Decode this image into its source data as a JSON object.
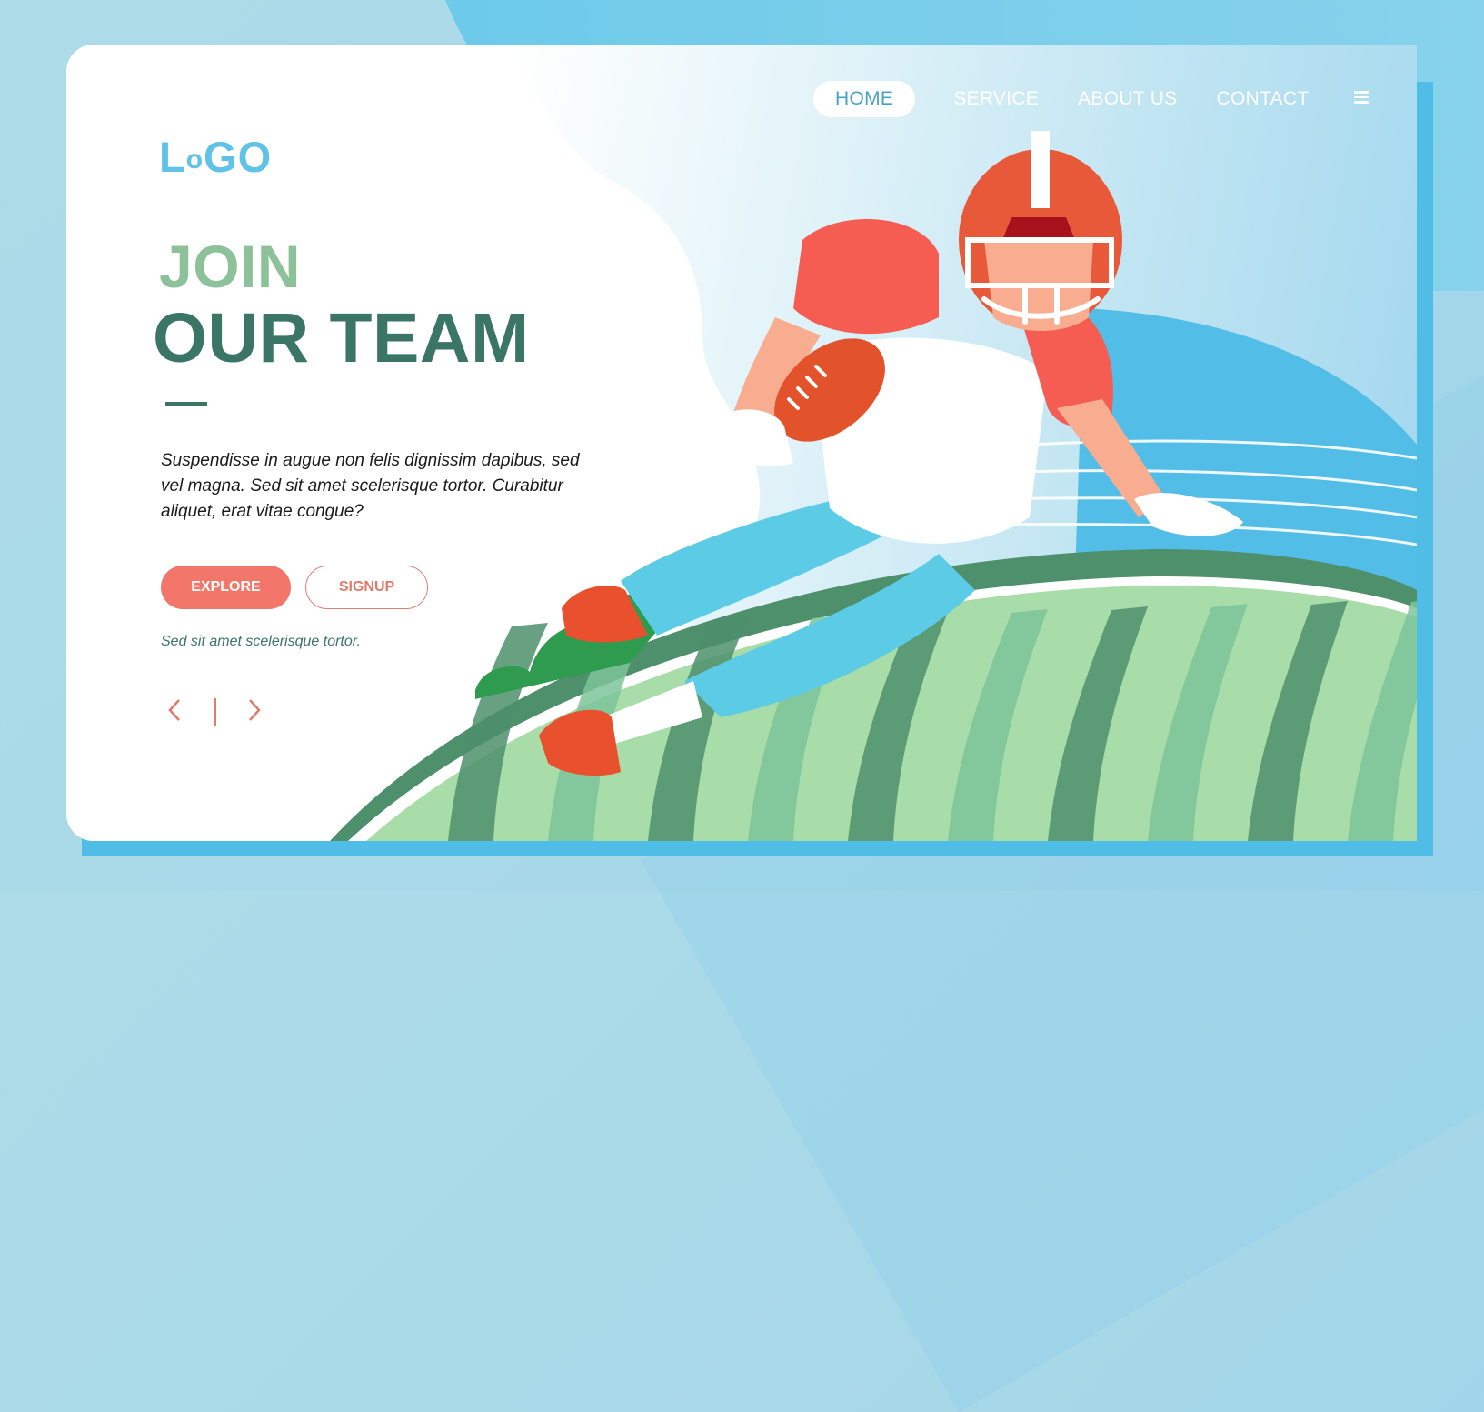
{
  "brand": {
    "logo_text": "LoGO",
    "logo_main_1": "L",
    "logo_small_o": "o",
    "logo_main_2": "GO"
  },
  "nav": {
    "items": [
      {
        "label": "HOME",
        "active": true
      },
      {
        "label": "SERVICE",
        "active": false
      },
      {
        "label": "ABOUT US",
        "active": false
      },
      {
        "label": "CONTACT",
        "active": false
      }
    ],
    "menu_icon": "hamburger-menu-icon"
  },
  "hero": {
    "headline_line1": "JOIN",
    "headline_line2": "OUR TEAM",
    "body": "Suspendisse in augue non felis dignissim dapibus, sed vel magna. Sed sit amet scelerisque tortor. Curabitur aliquet, erat vitae congue?",
    "primary_button": "EXPLORE",
    "secondary_button": "SIGNUP",
    "tagline": "Sed sit amet scelerisque tortor."
  },
  "pager": {
    "prev_icon": "chevron-left-icon",
    "next_icon": "chevron-right-icon"
  },
  "colors": {
    "accent_coral": "#f2766a",
    "headline_dark_green": "#3b7566",
    "headline_light_green": "#8cc199",
    "logo_blue": "#5fc2e6",
    "field_light": "#a8dca8",
    "field_dark": "#4e8f6c",
    "helmet": "#e8593a",
    "jersey": "#f55d52",
    "pants": "#5ccbe6"
  },
  "illustration": {
    "subject": "american-football-player-running-with-ball"
  }
}
